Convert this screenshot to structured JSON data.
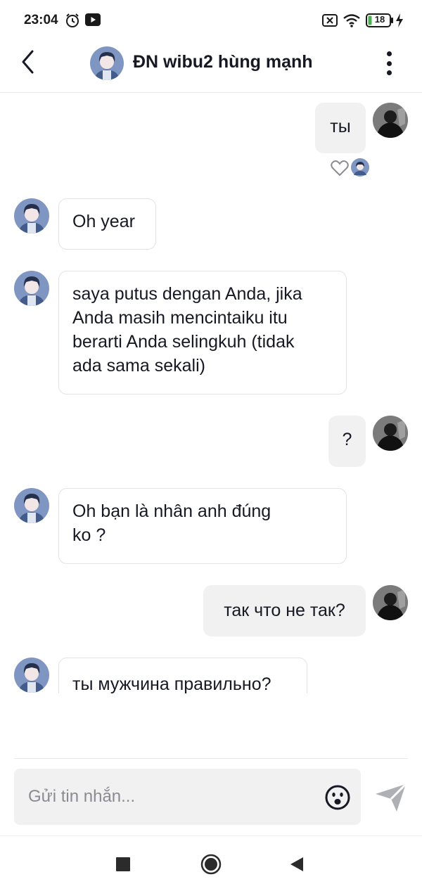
{
  "status_bar": {
    "time": "23:04",
    "battery": "18"
  },
  "header": {
    "title": "ĐN wibu2 hùng mạnh"
  },
  "messages": [
    {
      "direction": "out",
      "text": "ты"
    },
    {
      "direction": "in",
      "text": "Oh year"
    },
    {
      "direction": "in",
      "lines": [
        "saya putus dengan Anda, jika",
        "Anda masih mencintaiku itu",
        "berarti Anda selingkuh (tidak",
        "ada sama sekali)"
      ]
    },
    {
      "direction": "out",
      "text": "?"
    },
    {
      "direction": "in",
      "lines": [
        "Oh bạn là nhân anh đúng",
        "ko ?"
      ]
    },
    {
      "direction": "out",
      "text": "так что не так?"
    },
    {
      "direction": "in",
      "text": "ты мужчина правильно?"
    }
  ],
  "composer": {
    "placeholder": "Gửi tin nhắn..."
  },
  "icons": {
    "back": "chevron-left-icon",
    "more": "more-vertical-icon",
    "like": "heart-outline-icon",
    "emoji": "emoji-icon",
    "send": "send-icon",
    "nav_recent": "square-icon",
    "nav_home": "circle-icon",
    "nav_back": "triangle-left-icon"
  },
  "colors": {
    "bubble_out": "#f1f1f2",
    "bubble_in_border": "#e3e3e6",
    "text": "#161823",
    "placeholder": "#8a8b91"
  }
}
